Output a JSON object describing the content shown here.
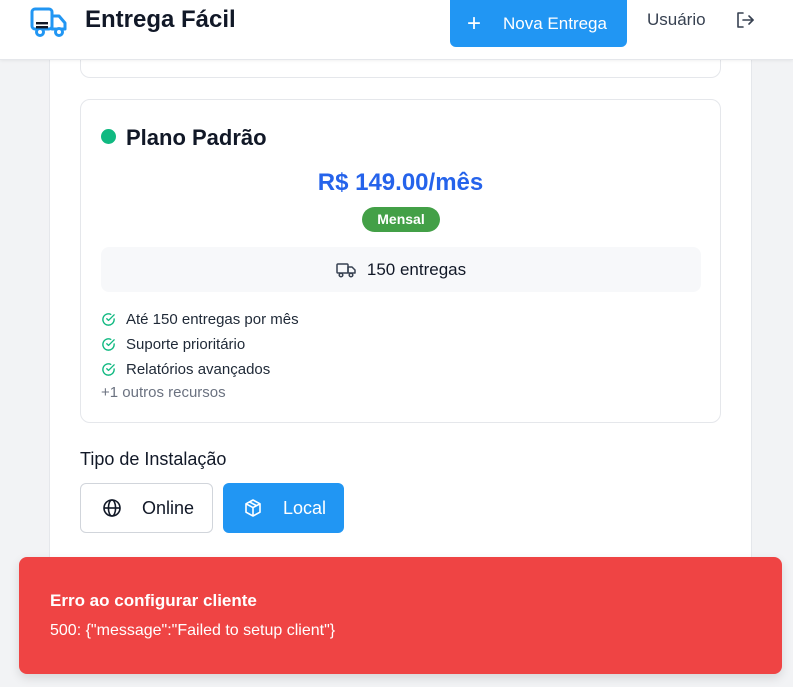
{
  "header": {
    "app_title": "Entrega Fácil",
    "logo_icon": "truck-icon",
    "new_delivery_label": "Nova Entrega",
    "new_delivery_icon": "plus-icon",
    "user_label": "Usuário",
    "logout_icon": "logout-icon"
  },
  "plan": {
    "name": "Plano Padrão",
    "status_color": "#10b981",
    "price": "R$ 149.00/mês",
    "period_badge": "Mensal",
    "deliveries": "150 entregas",
    "features": [
      "Até 150 entregas por mês",
      "Suporte prioritário",
      "Relatórios avançados"
    ],
    "more_features": "+1 outros recursos"
  },
  "installation": {
    "label": "Tipo de Instalação",
    "options": [
      {
        "label": "Online",
        "icon": "globe-icon",
        "selected": false
      },
      {
        "label": "Local",
        "icon": "box-icon",
        "selected": true
      }
    ]
  },
  "toast": {
    "title": "Erro ao configurar cliente",
    "message": "500: {\"message\":\"Failed to setup client\"}",
    "color": "#ef4444"
  },
  "colors": {
    "primary": "#2196f3",
    "price": "#2563eb",
    "badge": "#43a047",
    "check": "#10b981"
  }
}
